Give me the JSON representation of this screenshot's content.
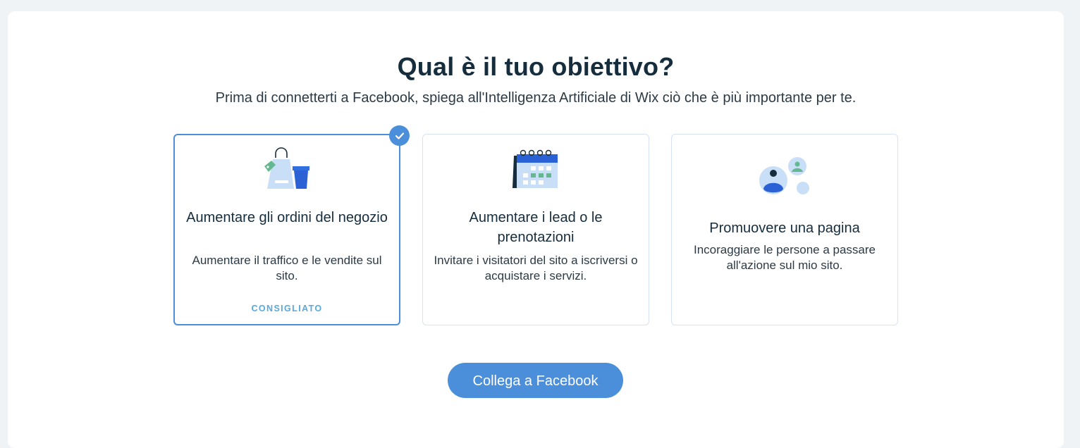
{
  "header": {
    "title": "Qual è il tuo obiettivo?",
    "subtitle": "Prima di connetterti a Facebook, spiega all'Intelligenza Artificiale di Wix ciò che è più importante per te."
  },
  "cards": [
    {
      "title": "Aumentare gli ordini del negozio",
      "description": "Aumentare il traffico e le vendite sul sito.",
      "badge": "CONSIGLIATO",
      "selected": true,
      "icon": "shopping-bag-icon"
    },
    {
      "title": "Aumentare i lead o le prenotazioni",
      "description": "Invitare i visitatori del sito a iscriversi o acquistare i servizi.",
      "selected": false,
      "icon": "calendar-icon"
    },
    {
      "title": "Promuovere una pagina",
      "description": "Incoraggiare le persone a passare all'azione sul mio sito.",
      "selected": false,
      "icon": "people-icon"
    }
  ],
  "cta": {
    "label": "Collega a Facebook"
  },
  "colors": {
    "accent": "#4b8ed9",
    "badge": "#5aa8dd",
    "heading": "#162d3d",
    "background": "#eff3f6"
  }
}
